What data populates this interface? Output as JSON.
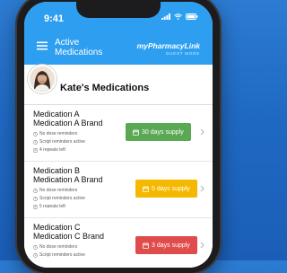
{
  "status_bar": {
    "time": "9:41"
  },
  "header": {
    "title": "Active Medications",
    "brand": "myPharmacyLink",
    "brand_sub": "GUEST MODE"
  },
  "profile": {
    "title": "Kate's Medications"
  },
  "medications": [
    {
      "name": "Medication A",
      "brand": "Medication A Brand",
      "dose": "No dose reminders",
      "script": "Script reminders active",
      "repeats": "4 repeats left",
      "supply": "30 days supply",
      "supply_color": "#5aa754"
    },
    {
      "name": "Medication B",
      "brand": "Medication A Brand",
      "dose": "No dose reminders",
      "script": "Script reminders active",
      "repeats": "5 repeats left",
      "supply": "5 days supply",
      "supply_color": "#f5b800"
    },
    {
      "name": "Medication C",
      "brand": "Medication C Brand",
      "dose": "No dose reminders",
      "script": "Script reminders active",
      "repeats": "",
      "supply": "3 days supply",
      "supply_color": "#e04b4b"
    }
  ],
  "colors": {
    "app_bar": "#2e9ff0",
    "background": "#1f69c3"
  }
}
